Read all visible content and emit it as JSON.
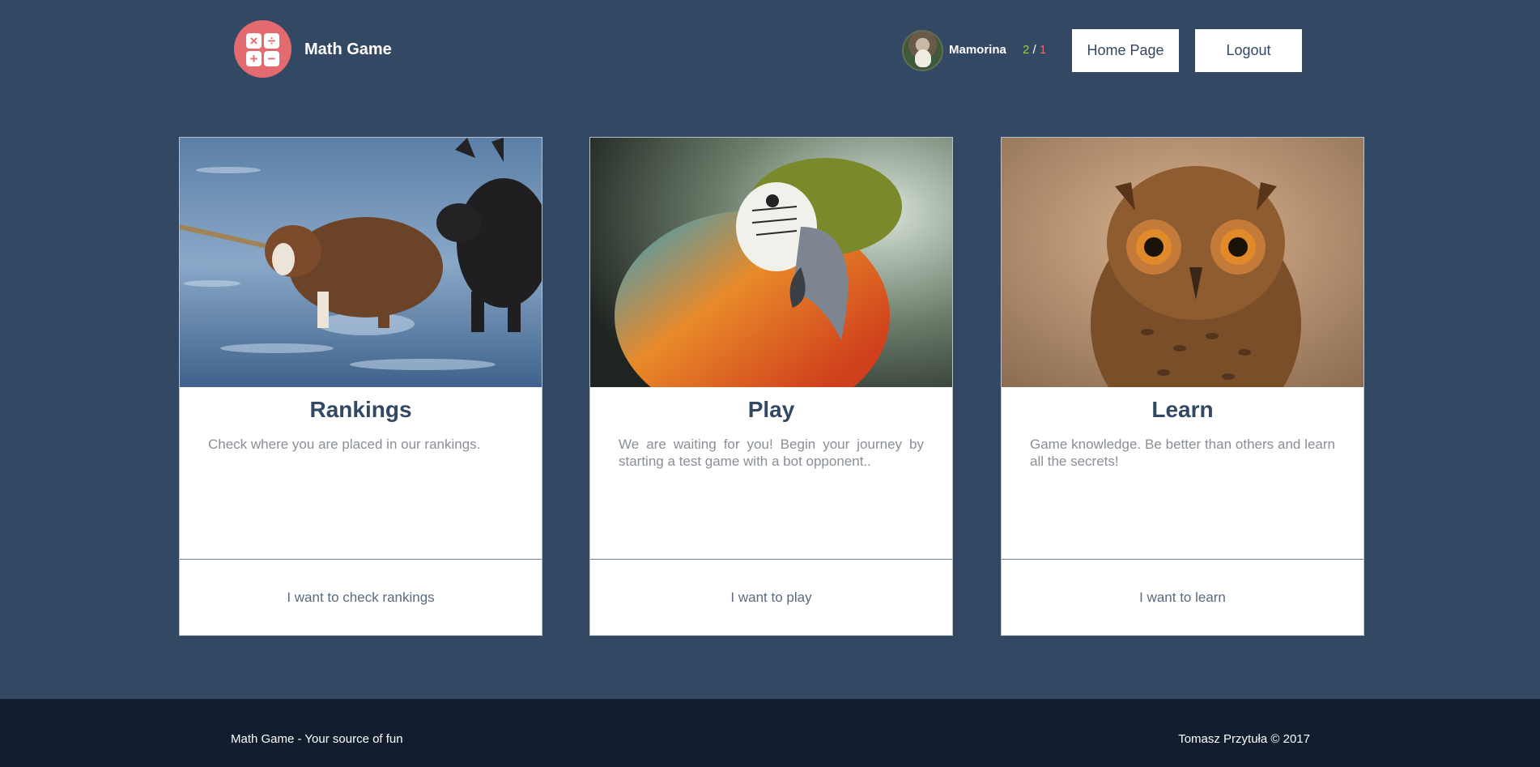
{
  "header": {
    "app_title": "Math Game",
    "logo_symbols": [
      "×",
      "÷",
      "+",
      "−"
    ],
    "user": {
      "name": "Mamorina",
      "score_won": "2",
      "score_separator": "/",
      "score_lost": "1"
    },
    "buttons": {
      "home": "Home Page",
      "logout": "Logout"
    }
  },
  "cards": [
    {
      "title": "Rankings",
      "text": "Check where you are placed in our rankings.",
      "link": "I want to check rankings",
      "image": "dogs-in-water"
    },
    {
      "title": "Play",
      "text": "We are waiting for you! Begin your journey by starting a test game with a bot opponent..",
      "link": "I want to play",
      "image": "macaw-parrot"
    },
    {
      "title": "Learn",
      "text": "Game knowledge. Be better than others and learn all the secrets!",
      "link": "I want to learn",
      "image": "owl"
    }
  ],
  "footer": {
    "left": "Math Game - Your source of fun",
    "right": "Tomasz Przytuła © 2017"
  },
  "colors": {
    "background": "#334862",
    "footer": "#121e2f",
    "accent": "#e36a6e",
    "score_won": "#9acd32"
  }
}
